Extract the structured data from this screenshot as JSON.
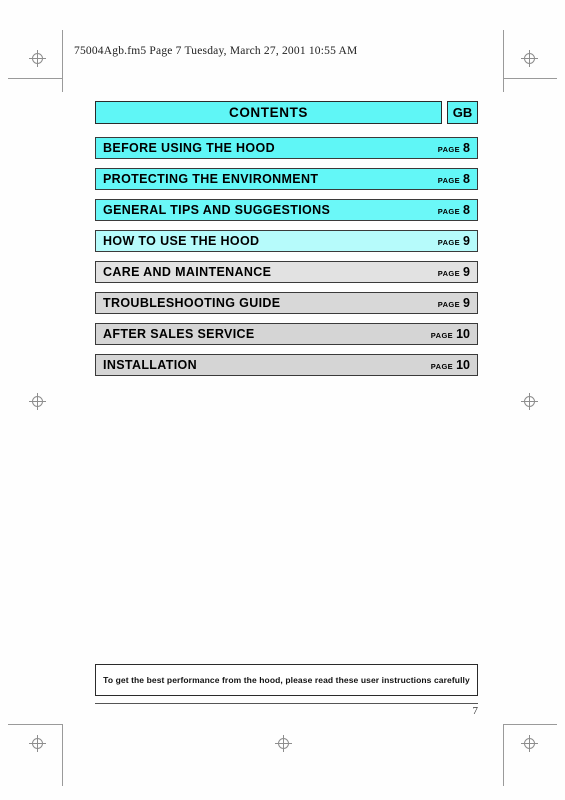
{
  "header": {
    "running_head": "75004Agb.fm5  Page 7  Tuesday, March 27, 2001  10:55 AM"
  },
  "title_bar": {
    "title": "CONTENTS",
    "language_code": "GB",
    "background_color": "#5ff6f6",
    "border_color": "#2b2b2b"
  },
  "contents": {
    "page_word": "PAGE",
    "rows": [
      {
        "label": "BEFORE USING THE HOOD",
        "page_word": "PAGE",
        "page": "8",
        "background_color": "#5ff6f6"
      },
      {
        "label": "PROTECTING THE ENVIRONMENT",
        "page_word": "PAGE",
        "page": "8",
        "background_color": "#63f7f7"
      },
      {
        "label": "GENERAL TIPS AND SUGGESTIONS",
        "page_word": "PAGE",
        "page": "8",
        "background_color": "#6bf8f8"
      },
      {
        "label": "HOW TO USE THE HOOD",
        "page_word": "PAGE",
        "page": "9",
        "background_color": "#b6fbfb"
      },
      {
        "label": "CARE AND MAINTENANCE",
        "page_word": "PAGE",
        "page": "9",
        "background_color": "#e2e2e2"
      },
      {
        "label": "TROUBLESHOOTING GUIDE",
        "page_word": "PAGE",
        "page": "9",
        "background_color": "#d8d8d8"
      },
      {
        "label": "AFTER SALES SERVICE",
        "page_word": "PAGE",
        "page": "10",
        "background_color": "#d5d5d5"
      },
      {
        "label": "INSTALLATION",
        "page_word": "PAGE",
        "page": "10",
        "background_color": "#d5d5d5"
      }
    ]
  },
  "footer": {
    "note": "To get the best performance from the hood, please read these user instructions carefully",
    "page_number": "7"
  },
  "marks": {
    "registration_mark_name": "registration-target-mark",
    "crop_mark_color": "#9a9a9a"
  }
}
